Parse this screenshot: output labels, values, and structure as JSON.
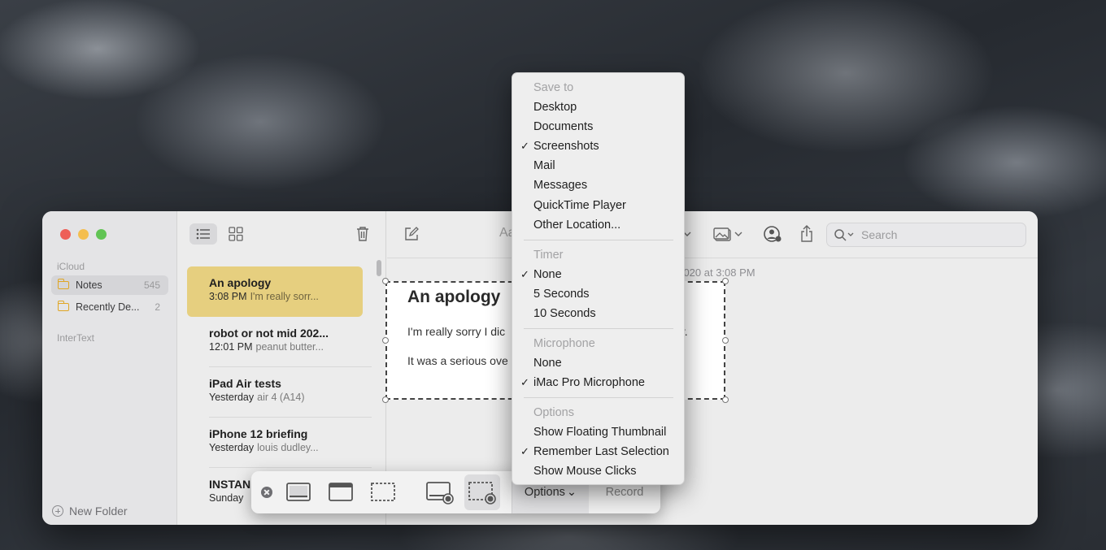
{
  "notes_app": {
    "sidebar": {
      "icloud_label": "iCloud",
      "folders": [
        {
          "name": "Notes",
          "count": "545"
        },
        {
          "name": "Recently De...",
          "count": "2"
        }
      ],
      "intertext_label": "InterText",
      "new_folder_label": "New Folder"
    },
    "notes_list": [
      {
        "title": "An apology",
        "time": "3:08 PM",
        "preview": "I'm really sorr..."
      },
      {
        "title": "robot or not mid 202...",
        "time": "12:01 PM",
        "preview": "peanut butter..."
      },
      {
        "title": "iPad Air tests",
        "time": "Yesterday",
        "preview": "air 4 (A14)"
      },
      {
        "title": "iPhone 12 briefing",
        "time": "Yesterday",
        "preview": "louis dudley..."
      },
      {
        "title": "INSTAN",
        "time": "Sunday",
        "preview": ""
      }
    ],
    "editor": {
      "search_placeholder": "Search",
      "aa_label": "Aa",
      "date_line": ", 2020 at 3:08 PM",
      "note_title": "An apology",
      "line1": "I'm really sorry I dic",
      "line1_tail": "gy.",
      "line2": "It was a serious ove"
    }
  },
  "screenshot_toolbar": {
    "options_label": "Options",
    "options_chevron": "⌄",
    "record_label": "Record",
    "modes": [
      "capture-entire-screen-icon",
      "capture-window-icon",
      "capture-selection-icon",
      "record-screen-icon",
      "record-selection-icon"
    ],
    "active_mode": "record-selection-icon"
  },
  "options_menu": {
    "save_to_header": "Save to",
    "save_to_items": [
      {
        "label": "Desktop",
        "checked": false
      },
      {
        "label": "Documents",
        "checked": false
      },
      {
        "label": "Screenshots",
        "checked": true
      },
      {
        "label": "Mail",
        "checked": false
      },
      {
        "label": "Messages",
        "checked": false
      },
      {
        "label": "QuickTime Player",
        "checked": false
      },
      {
        "label": "Other Location...",
        "checked": false
      }
    ],
    "timer_header": "Timer",
    "timer_items": [
      {
        "label": "None",
        "checked": true
      },
      {
        "label": "5 Seconds",
        "checked": false
      },
      {
        "label": "10 Seconds",
        "checked": false
      }
    ],
    "microphone_header": "Microphone",
    "microphone_items": [
      {
        "label": "None",
        "checked": false
      },
      {
        "label": "iMac Pro Microphone",
        "checked": true
      }
    ],
    "options_header": "Options",
    "options_items": [
      {
        "label": "Show Floating Thumbnail",
        "checked": false
      },
      {
        "label": "Remember Last Selection",
        "checked": true
      },
      {
        "label": "Show Mouse Clicks",
        "checked": false
      }
    ],
    "check_glyph": "✓"
  }
}
